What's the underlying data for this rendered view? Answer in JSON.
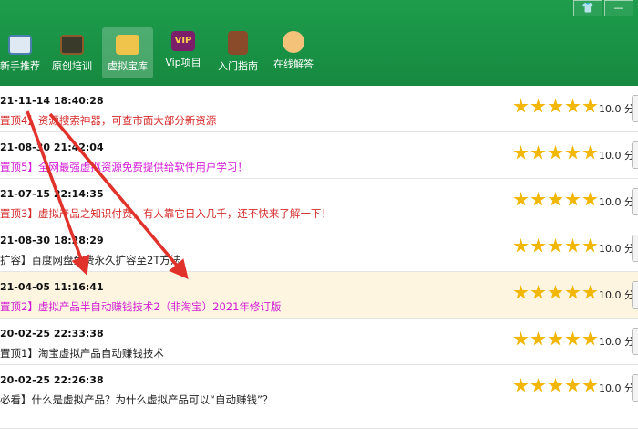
{
  "window": {
    "skin_icon": "shirt-icon",
    "minimize_icon": "minimize-icon"
  },
  "nav": [
    {
      "label": "新手推荐",
      "icon": "monitor-icon"
    },
    {
      "label": "原创培训",
      "icon": "blackboard-icon"
    },
    {
      "label": "虚拟宝库",
      "icon": "treasure-icon",
      "active": true
    },
    {
      "label": "Vip项目",
      "icon": "vip-icon",
      "icon_text": "VIP"
    },
    {
      "label": "入门指南",
      "icon": "book-icon"
    },
    {
      "label": "在线解答",
      "icon": "support-icon"
    }
  ],
  "rows": [
    {
      "time": "21-11-14 18:40:28",
      "title": "置顶4】资源搜索神器，可查市面大部分新资源",
      "score": "10.0 分",
      "color": "#d42a2a"
    },
    {
      "time": "21-08-30 21:42:04",
      "title": "置顶5】全网最强虚拟资源免费提供给软件用户学习！",
      "score": "10.0 分",
      "color": "#d21bd4"
    },
    {
      "time": "21-07-15 22:14:35",
      "title": "置顶3】虚拟产品之知识付费，有人靠它日入几千，还不快来了解一下！",
      "score": "10.0 分",
      "color": "#d42a2a"
    },
    {
      "time": "21-08-30 18:28:29",
      "title": "扩容】百度网盘免费永久扩容至2T方法",
      "score": "10.0 分",
      "color": "#222222"
    },
    {
      "time": "21-04-05 11:16:41",
      "title": "置顶2】虚拟产品半自动赚钱技术2（非淘宝）2021年修订版",
      "score": "10.0 分",
      "color": "#d21bd4",
      "highlight": true
    },
    {
      "time": "20-02-25 22:33:38",
      "title": "置顶1】淘宝虚拟产品自动赚钱技术",
      "score": "10.0 分",
      "color": "#222222"
    },
    {
      "time": "20-02-25 22:26:38",
      "title": "必看】什么是虚拟产品？为什么虚拟产品可以“自动赚钱”？",
      "score": "10.0 分",
      "color": "#222222"
    }
  ],
  "rating_stars": 5,
  "accent": "#1e9c4c",
  "arrow_color": "#e0312a"
}
